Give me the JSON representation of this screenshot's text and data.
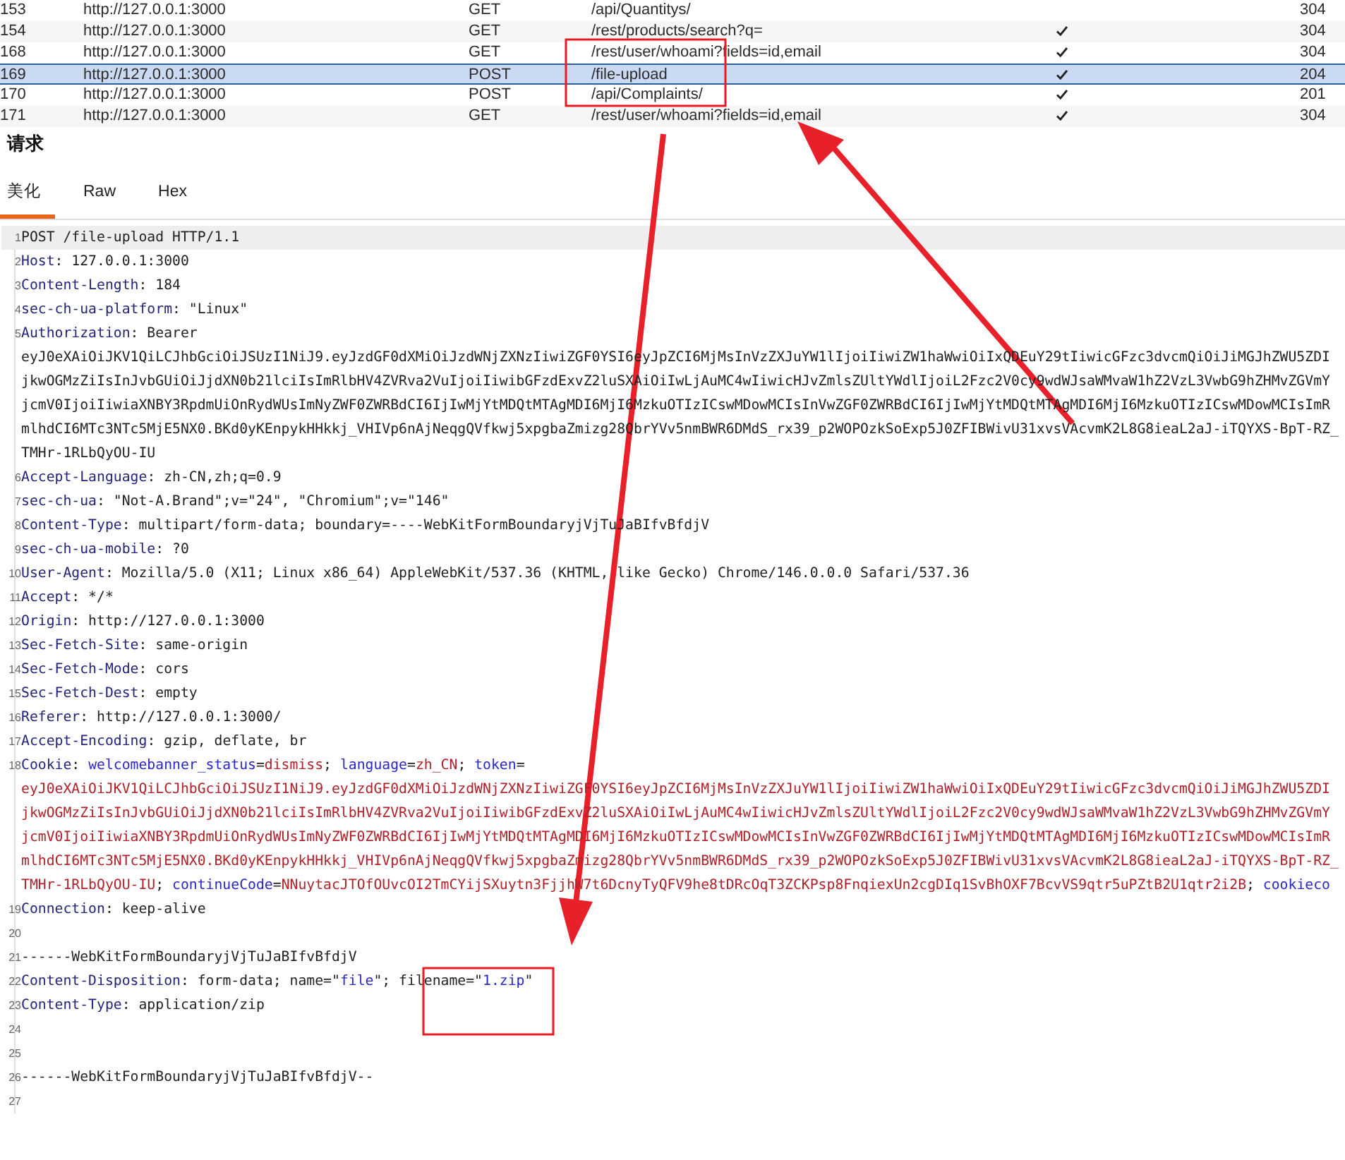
{
  "history": {
    "rows": [
      {
        "number": "153",
        "host": "http://127.0.0.1:3000",
        "method": "GET",
        "url": "/api/Quantitys/",
        "checked": false,
        "status": "304",
        "selected": false
      },
      {
        "number": "154",
        "host": "http://127.0.0.1:3000",
        "method": "GET",
        "url": "/rest/products/search?q=",
        "checked": true,
        "status": "304",
        "selected": false
      },
      {
        "number": "168",
        "host": "http://127.0.0.1:3000",
        "method": "GET",
        "url": "/rest/user/whoami?fields=id,email",
        "checked": true,
        "status": "304",
        "selected": false
      },
      {
        "number": "169",
        "host": "http://127.0.0.1:3000",
        "method": "POST",
        "url": "/file-upload",
        "checked": true,
        "status": "204",
        "selected": true
      },
      {
        "number": "170",
        "host": "http://127.0.0.1:3000",
        "method": "POST",
        "url": "/api/Complaints/",
        "checked": true,
        "status": "201",
        "selected": false
      },
      {
        "number": "171",
        "host": "http://127.0.0.1:3000",
        "method": "GET",
        "url": "/rest/user/whoami?fields=id,email",
        "checked": true,
        "status": "304",
        "selected": false
      }
    ]
  },
  "request": {
    "title": "请求",
    "tabs": [
      {
        "label": "美化",
        "selected": true
      },
      {
        "label": "Raw",
        "selected": false
      },
      {
        "label": "Hex",
        "selected": false
      }
    ],
    "lines": [
      {
        "number": "1",
        "current": true,
        "rows": [
          {
            "segments": [
              {
                "kind": "plain",
                "text": "POST /file-upload HTTP/1.1"
              }
            ]
          }
        ]
      },
      {
        "number": "2",
        "current": false,
        "rows": [
          {
            "segments": [
              {
                "kind": "name",
                "text": "Host"
              },
              {
                "kind": "plain",
                "text": ": 127.0.0.1:3000"
              }
            ]
          }
        ]
      },
      {
        "number": "3",
        "current": false,
        "rows": [
          {
            "segments": [
              {
                "kind": "name",
                "text": "Content-Length"
              },
              {
                "kind": "plain",
                "text": ": 184"
              }
            ]
          }
        ]
      },
      {
        "number": "4",
        "current": false,
        "rows": [
          {
            "segments": [
              {
                "kind": "name",
                "text": "sec-ch-ua-platform"
              },
              {
                "kind": "plain",
                "text": ": \"Linux\""
              }
            ]
          }
        ]
      },
      {
        "number": "5",
        "current": false,
        "rows": [
          {
            "segments": [
              {
                "kind": "name",
                "text": "Authorization"
              },
              {
                "kind": "plain",
                "text": ": Bearer"
              }
            ]
          },
          {
            "segments": [
              {
                "kind": "plain",
                "text": "eyJ0eXAiOiJKV1QiLCJhbGciOiJSUzI1NiJ9.eyJzdGF0dXMiOiJzdWNjZXNzIiwiZGF0YSI6eyJpZCI6MjMsInVzZXJuYW1lIjoiIiwiZW1haWwiOiIxQDEuY29tIiwicGFzc3dvcmQiOiJiMGJhZWU5ZDI"
              }
            ]
          },
          {
            "segments": [
              {
                "kind": "plain",
                "text": "jkwOGMzZiIsInJvbGUiOiJjdXN0b21lciIsImRlbHV4ZVRva2VuIjoiIiwibGFzdExvZ2luSXAiOiIwLjAuMC4wIiwicHJvZmlsZUltYWdlIjoiL2Fzc2V0cy9wdWJsaWMvaW1hZ2VzL3VwbG9hZHMvZGVmY"
              }
            ]
          },
          {
            "segments": [
              {
                "kind": "plain",
                "text": "jcmV0IjoiIiwiaXNBY3RpdmUiOnRydWUsImNyZWF0ZWRBdCI6IjIwMjYtMDQtMTAgMDI6MjI6MzkuOTIzICswMDowMCIsInVwZGF0ZWRBdCI6IjIwMjYtMDQtMTAgMDI6MjI6MzkuOTIzICswMDowMCIsImR"
              }
            ]
          },
          {
            "segments": [
              {
                "kind": "plain",
                "text": "mlhdCI6MTc3NTc5MjE5NX0.BKd0yKEnpykHHkkj_VHIVp6nAjNeqgQVfkwj5xpgbaZmizg28QbrYVv5nmBWR6DMdS_rx39_p2WOPOzkSoExp5J0ZFIBWivU31xvsVAcvmK2L8G8ieaL2aJ-iTQYXS-BpT-RZ_"
              }
            ]
          },
          {
            "segments": [
              {
                "kind": "plain",
                "text": "TMHr-1RLbQyOU-IU"
              }
            ]
          }
        ]
      },
      {
        "number": "6",
        "current": false,
        "rows": [
          {
            "segments": [
              {
                "kind": "name",
                "text": "Accept-Language"
              },
              {
                "kind": "plain",
                "text": ": zh-CN,zh;q=0.9"
              }
            ]
          }
        ]
      },
      {
        "number": "7",
        "current": false,
        "rows": [
          {
            "segments": [
              {
                "kind": "name",
                "text": "sec-ch-ua"
              },
              {
                "kind": "plain",
                "text": ": \"Not-A.Brand\";v=\"24\", \"Chromium\";v=\"146\""
              }
            ]
          }
        ]
      },
      {
        "number": "8",
        "current": false,
        "rows": [
          {
            "segments": [
              {
                "kind": "name",
                "text": "Content-Type"
              },
              {
                "kind": "plain",
                "text": ": multipart/form-data; boundary=----WebKitFormBoundaryjVjTuJaBIfvBfdjV"
              }
            ]
          }
        ]
      },
      {
        "number": "9",
        "current": false,
        "rows": [
          {
            "segments": [
              {
                "kind": "name",
                "text": "sec-ch-ua-mobile"
              },
              {
                "kind": "plain",
                "text": ": ?0"
              }
            ]
          }
        ]
      },
      {
        "number": "10",
        "current": false,
        "rows": [
          {
            "segments": [
              {
                "kind": "name",
                "text": "User-Agent"
              },
              {
                "kind": "plain",
                "text": ": Mozilla/5.0 (X11; Linux x86_64) AppleWebKit/537.36 (KHTML, like Gecko) Chrome/146.0.0.0 Safari/537.36"
              }
            ]
          }
        ]
      },
      {
        "number": "11",
        "current": false,
        "rows": [
          {
            "segments": [
              {
                "kind": "name",
                "text": "Accept"
              },
              {
                "kind": "plain",
                "text": ": */*"
              }
            ]
          }
        ]
      },
      {
        "number": "12",
        "current": false,
        "rows": [
          {
            "segments": [
              {
                "kind": "name",
                "text": "Origin"
              },
              {
                "kind": "plain",
                "text": ": http://127.0.0.1:3000"
              }
            ]
          }
        ]
      },
      {
        "number": "13",
        "current": false,
        "rows": [
          {
            "segments": [
              {
                "kind": "name",
                "text": "Sec-Fetch-Site"
              },
              {
                "kind": "plain",
                "text": ": same-origin"
              }
            ]
          }
        ]
      },
      {
        "number": "14",
        "current": false,
        "rows": [
          {
            "segments": [
              {
                "kind": "name",
                "text": "Sec-Fetch-Mode"
              },
              {
                "kind": "plain",
                "text": ": cors"
              }
            ]
          }
        ]
      },
      {
        "number": "15",
        "current": false,
        "rows": [
          {
            "segments": [
              {
                "kind": "name",
                "text": "Sec-Fetch-Dest"
              },
              {
                "kind": "plain",
                "text": ": empty"
              }
            ]
          }
        ]
      },
      {
        "number": "16",
        "current": false,
        "rows": [
          {
            "segments": [
              {
                "kind": "name",
                "text": "Referer"
              },
              {
                "kind": "plain",
                "text": ": http://127.0.0.1:3000/"
              }
            ]
          }
        ]
      },
      {
        "number": "17",
        "current": false,
        "rows": [
          {
            "segments": [
              {
                "kind": "name",
                "text": "Accept-Encoding"
              },
              {
                "kind": "plain",
                "text": ": gzip, deflate, br"
              }
            ]
          }
        ]
      },
      {
        "number": "18",
        "current": false,
        "rows": [
          {
            "segments": [
              {
                "kind": "name",
                "text": "Cookie"
              },
              {
                "kind": "plain",
                "text": ": "
              },
              {
                "kind": "key",
                "text": "welcomebanner_status"
              },
              {
                "kind": "plain",
                "text": "="
              },
              {
                "kind": "value",
                "text": "dismiss"
              },
              {
                "kind": "plain",
                "text": "; "
              },
              {
                "kind": "key",
                "text": "language"
              },
              {
                "kind": "plain",
                "text": "="
              },
              {
                "kind": "value",
                "text": "zh_CN"
              },
              {
                "kind": "plain",
                "text": "; "
              },
              {
                "kind": "key",
                "text": "token"
              },
              {
                "kind": "plain",
                "text": "="
              }
            ]
          },
          {
            "segments": [
              {
                "kind": "value",
                "text": "eyJ0eXAiOiJKV1QiLCJhbGciOiJSUzI1NiJ9.eyJzdGF0dXMiOiJzdWNjZXNzIiwiZGF0YSI6eyJpZCI6MjMsInVzZXJuYW1lIjoiIiwiZW1haWwiOiIxQDEuY29tIiwicGFzc3dvcmQiOiJiMGJhZWU5ZDI"
              }
            ]
          },
          {
            "segments": [
              {
                "kind": "value",
                "text": "jkwOGMzZiIsInJvbGUiOiJjdXN0b21lciIsImRlbHV4ZVRva2VuIjoiIiwibGFzdExvZ2luSXAiOiIwLjAuMC4wIiwicHJvZmlsZUltYWdlIjoiL2Fzc2V0cy9wdWJsaWMvaW1hZ2VzL3VwbG9hZHMvZGVmY"
              }
            ]
          },
          {
            "segments": [
              {
                "kind": "value",
                "text": "jcmV0IjoiIiwiaXNBY3RpdmUiOnRydWUsImNyZWF0ZWRBdCI6IjIwMjYtMDQtMTAgMDI6MjI6MzkuOTIzICswMDowMCIsInVwZGF0ZWRBdCI6IjIwMjYtMDQtMTAgMDI6MjI6MzkuOTIzICswMDowMCIsImR"
              }
            ]
          },
          {
            "segments": [
              {
                "kind": "value",
                "text": "mlhdCI6MTc3NTc5MjE5NX0.BKd0yKEnpykHHkkj_VHIVp6nAjNeqgQVfkwj5xpgbaZmizg28QbrYVv5nmBWR6DMdS_rx39_p2WOPOzkSoExp5J0ZFIBWivU31xvsVAcvmK2L8G8ieaL2aJ-iTQYXS-BpT-RZ_"
              }
            ]
          },
          {
            "segments": [
              {
                "kind": "value",
                "text": "TMHr-1RLbQyOU-IU"
              },
              {
                "kind": "plain",
                "text": "; "
              },
              {
                "kind": "key",
                "text": "continueCode"
              },
              {
                "kind": "plain",
                "text": "="
              },
              {
                "kind": "value",
                "text": "NNuytacJTOfOUvcOI2TmCYijSXuytn3FjjhW7t6DcnyTyQFV9he8tDRcOqT3ZCKPsp8FnqiexUn2cgDIq1SvBhOXF7BcvVS9qtr5uPZtB2U1qtr2i2B"
              },
              {
                "kind": "plain",
                "text": "; "
              },
              {
                "kind": "key",
                "text": "cookieco"
              }
            ]
          }
        ]
      },
      {
        "number": "19",
        "current": false,
        "rows": [
          {
            "segments": [
              {
                "kind": "name",
                "text": "Connection"
              },
              {
                "kind": "plain",
                "text": ": keep-alive"
              }
            ]
          }
        ]
      },
      {
        "number": "20",
        "current": false,
        "rows": [
          {
            "segments": []
          }
        ]
      },
      {
        "number": "21",
        "current": false,
        "rows": [
          {
            "segments": [
              {
                "kind": "plain",
                "text": "------WebKitFormBoundaryjVjTuJaBIfvBfdjV"
              }
            ]
          }
        ]
      },
      {
        "number": "22",
        "current": false,
        "rows": [
          {
            "segments": [
              {
                "kind": "name",
                "text": "Content-Disposition"
              },
              {
                "kind": "plain",
                "text": ": form-data; name=\""
              },
              {
                "kind": "key",
                "text": "file"
              },
              {
                "kind": "plain",
                "text": "\"; filename=\""
              },
              {
                "kind": "key",
                "text": "1.zip"
              },
              {
                "kind": "plain",
                "text": "\""
              }
            ]
          }
        ]
      },
      {
        "number": "23",
        "current": false,
        "rows": [
          {
            "segments": [
              {
                "kind": "name",
                "text": "Content-Type"
              },
              {
                "kind": "plain",
                "text": ": application/zip"
              }
            ]
          }
        ]
      },
      {
        "number": "24",
        "current": false,
        "rows": [
          {
            "segments": []
          }
        ]
      },
      {
        "number": "25",
        "current": false,
        "rows": [
          {
            "segments": []
          }
        ]
      },
      {
        "number": "26",
        "current": false,
        "rows": [
          {
            "segments": [
              {
                "kind": "plain",
                "text": "------WebKitFormBoundaryjVjTuJaBIfvBfdjV--"
              }
            ]
          }
        ]
      },
      {
        "number": "27",
        "current": false,
        "rows": [
          {
            "segments": []
          }
        ]
      }
    ]
  }
}
